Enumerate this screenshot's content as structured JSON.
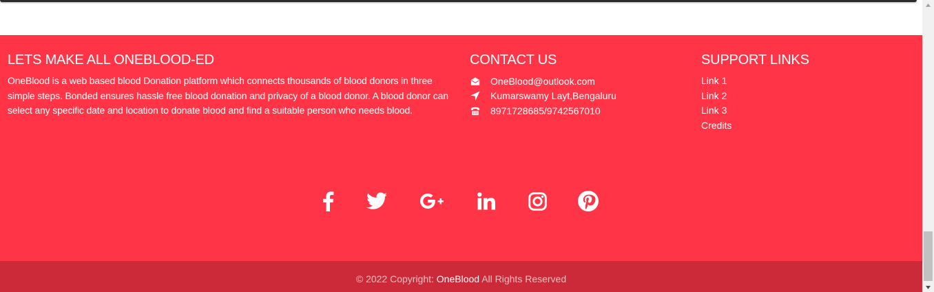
{
  "about": {
    "heading": "LETS MAKE ALL ONEBLOOD-ED",
    "text": "OneBlood is a web based blood Donation platform which connects thousands of blood donors in three simple steps. Bonded ensures hassle free blood donation and privacy of a blood donor. A blood donor can select any specific date and location to donate blood and find a suitable person who needs blood."
  },
  "contact": {
    "heading": "CONTACT US",
    "items": [
      {
        "icon": "envelope-open-icon",
        "text": "OneBlood@outlook.com"
      },
      {
        "icon": "location-arrow-icon",
        "text": "Kumarswamy Layt,Bengaluru"
      },
      {
        "icon": "phone-icon",
        "text": "8971728685/9742567010"
      }
    ]
  },
  "support": {
    "heading": "SUPPORT LINKS",
    "links": [
      "Link 1",
      "Link 2",
      "Link 3",
      "Credits"
    ]
  },
  "social": {
    "icons": [
      "facebook-icon",
      "twitter-icon",
      "google-plus-icon",
      "linkedin-icon",
      "instagram-icon",
      "pinterest-icon"
    ]
  },
  "copyright": {
    "prefix": "© 2022 Copyright: ",
    "brand": "OneBlood",
    "suffix": " All Rights Reserved"
  },
  "colors": {
    "footer_bg": "#ff3547",
    "copyright_bg": "#cc2a39",
    "text": "#ffffff"
  }
}
